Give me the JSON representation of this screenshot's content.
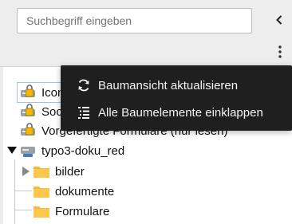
{
  "search": {
    "placeholder": "Suchbegriff eingeben"
  },
  "toolbar": {
    "collapse_icon": "chevron-left-icon",
    "menu_icon": "kebab-menu-icon"
  },
  "context_menu": {
    "items": [
      {
        "label": "Baumansicht aktualisieren",
        "icon": "refresh-icon"
      },
      {
        "label": "Alle Baumelemente einklappen",
        "icon": "collapse-tree-icon"
      }
    ]
  },
  "tree": {
    "storages": [
      {
        "label": "Icons",
        "icon": "locked-storage-icon",
        "selected": true
      },
      {
        "label": "Social Media",
        "icon": "locked-storage-icon"
      },
      {
        "label": "Vorgefertigte Formulare (nur lesen)",
        "icon": "locked-storage-icon"
      },
      {
        "label": "typo3-doku_red",
        "icon": "storage-icon",
        "expanded": true
      }
    ],
    "folders": [
      {
        "label": "bilder",
        "icon": "folder-icon",
        "has_children": true
      },
      {
        "label": "dokumente",
        "icon": "folder-icon"
      },
      {
        "label": "Formulare",
        "icon": "folder-icon"
      }
    ]
  },
  "colors": {
    "menu_bg": "#1f1f1f",
    "folder": "#f6b93b",
    "selection": "#9cc2e6"
  }
}
